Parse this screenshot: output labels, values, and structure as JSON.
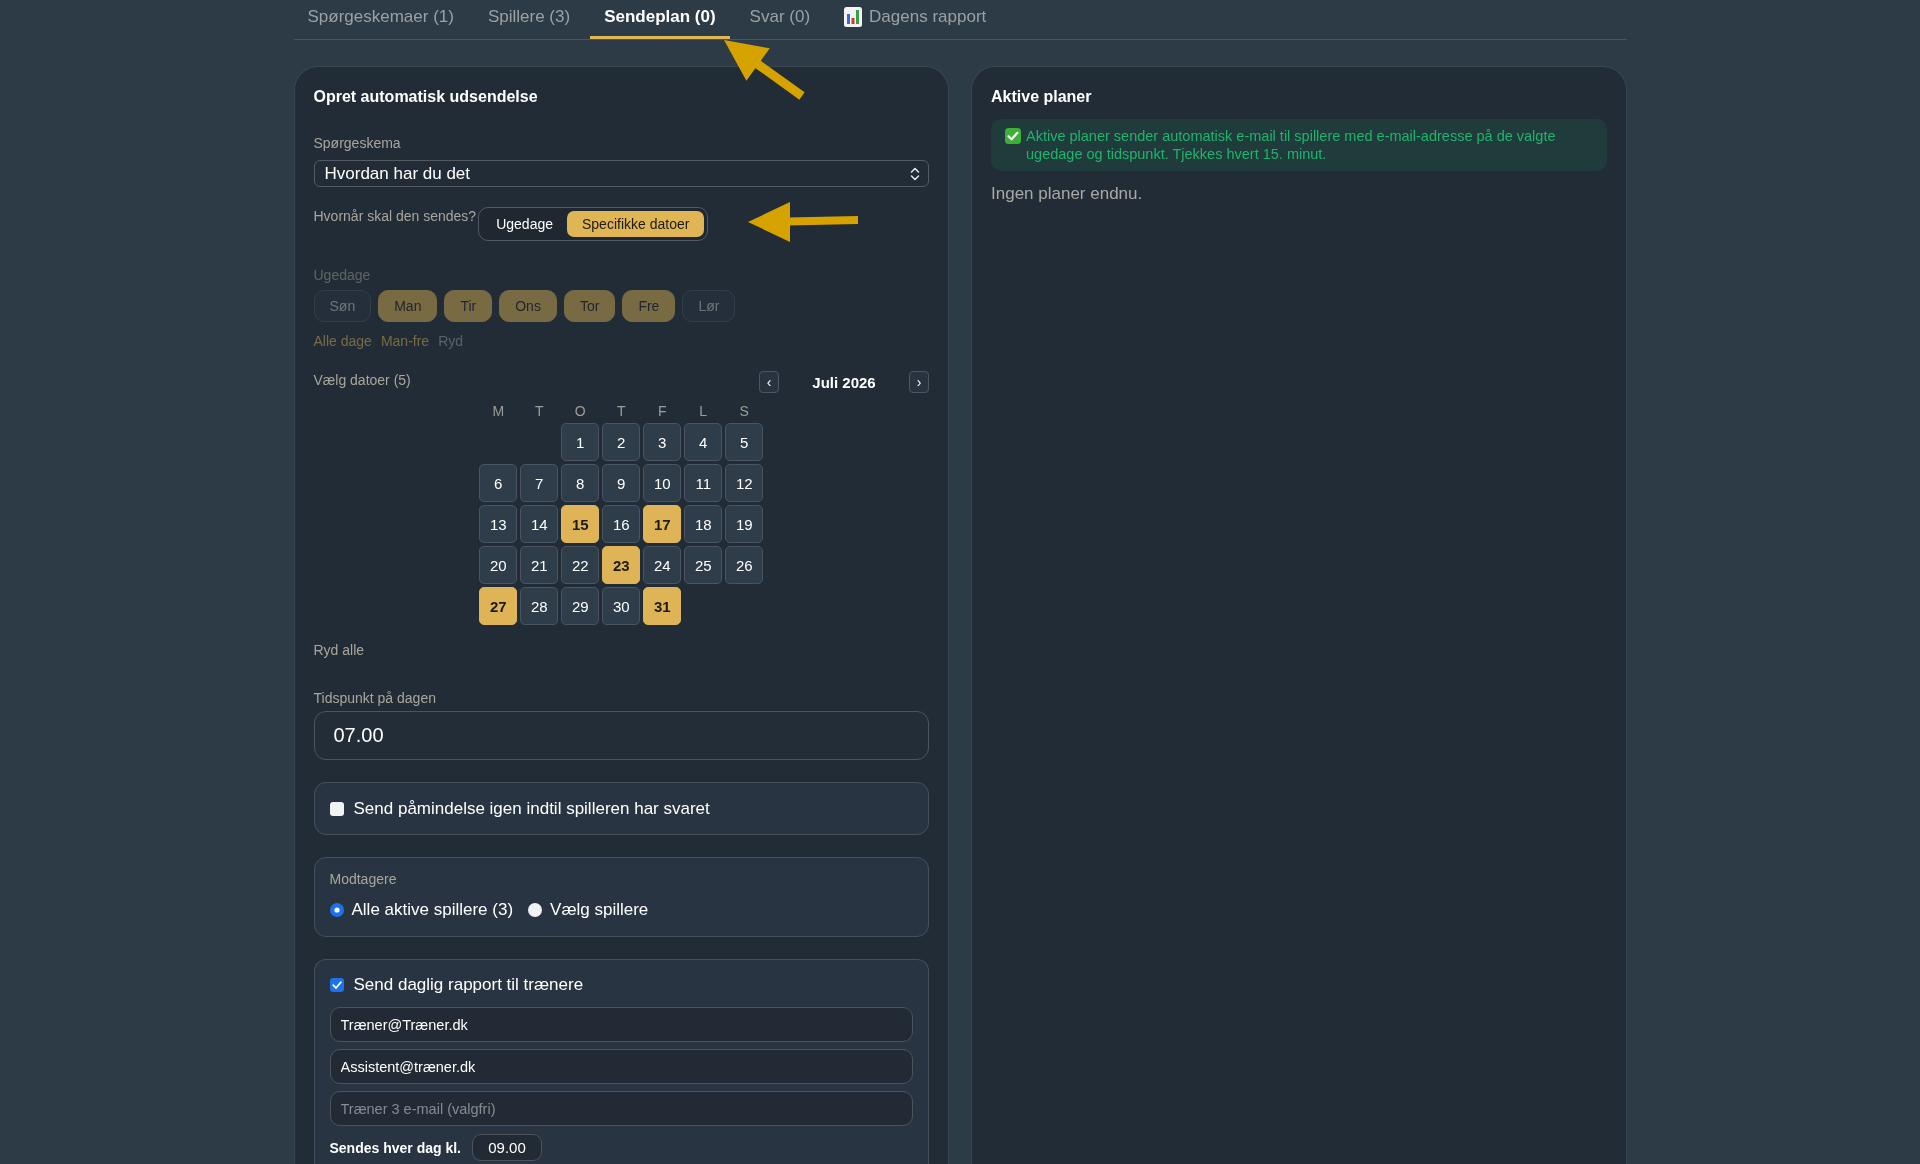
{
  "tabs": [
    {
      "label": "Spørgeskemaer (1)",
      "selected": false,
      "kind": "text"
    },
    {
      "label": "Spillere (3)",
      "selected": false,
      "kind": "text"
    },
    {
      "label": "Sendeplan (0)",
      "selected": true,
      "kind": "text"
    },
    {
      "label": "Svar (0)",
      "selected": false,
      "kind": "text"
    },
    {
      "label": "Dagens rapport",
      "selected": false,
      "kind": "report"
    }
  ],
  "create_panel": {
    "title": "Opret automatisk udsendelse",
    "questionnaire": {
      "label": "Spørgeskema",
      "value": "Hvordan har du det"
    },
    "send_mode": {
      "label": "Hvornår skal den sendes?",
      "options": [
        {
          "label": "Ugedage",
          "selected": false
        },
        {
          "label": "Specifikke datoer",
          "selected": true
        }
      ]
    },
    "weekdays": {
      "label": "Ugedage",
      "disabled": true,
      "days": [
        {
          "label": "Søn",
          "selected": false
        },
        {
          "label": "Man",
          "selected": true
        },
        {
          "label": "Tir",
          "selected": true
        },
        {
          "label": "Ons",
          "selected": true
        },
        {
          "label": "Tor",
          "selected": true
        },
        {
          "label": "Fre",
          "selected": true
        },
        {
          "label": "Lør",
          "selected": false
        }
      ],
      "shortcuts": [
        {
          "label": "Alle dage",
          "kind": "preset"
        },
        {
          "label": "Man-fre",
          "kind": "preset"
        },
        {
          "label": "Ryd",
          "kind": "clear"
        }
      ]
    },
    "date_picker": {
      "label": "Vælg datoer (5)",
      "prev": "‹",
      "month": "Juli 2026",
      "next": "›",
      "weekday_headers": [
        "M",
        "T",
        "O",
        "T",
        "F",
        "L",
        "S"
      ],
      "weeks": [
        [
          {
            "day": "1",
            "selected": false
          },
          {
            "day": "2",
            "selected": false
          },
          {
            "day": "3",
            "selected": false
          },
          {
            "day": "4",
            "selected": false
          },
          {
            "day": "5",
            "selected": false
          }
        ],
        [
          {
            "day": "6",
            "selected": false
          },
          {
            "day": "7",
            "selected": false
          },
          {
            "day": "8",
            "selected": false
          },
          {
            "day": "9",
            "selected": false
          },
          {
            "day": "10",
            "selected": false
          },
          {
            "day": "11",
            "selected": false
          },
          {
            "day": "12",
            "selected": false
          }
        ],
        [
          {
            "day": "13",
            "selected": false
          },
          {
            "day": "14",
            "selected": false
          },
          {
            "day": "15",
            "selected": true
          },
          {
            "day": "16",
            "selected": false
          },
          {
            "day": "17",
            "selected": true
          },
          {
            "day": "18",
            "selected": false
          },
          {
            "day": "19",
            "selected": false
          }
        ],
        [
          {
            "day": "20",
            "selected": false
          },
          {
            "day": "21",
            "selected": false
          },
          {
            "day": "22",
            "selected": false
          },
          {
            "day": "23",
            "selected": true
          },
          {
            "day": "24",
            "selected": false
          },
          {
            "day": "25",
            "selected": false
          },
          {
            "day": "26",
            "selected": false
          }
        ],
        [
          {
            "day": "27",
            "selected": true
          },
          {
            "day": "28",
            "selected": false
          },
          {
            "day": "29",
            "selected": false
          },
          {
            "day": "30",
            "selected": false
          },
          {
            "day": "31",
            "selected": true
          }
        ]
      ],
      "clear_label": "Ryd alle"
    },
    "time_of_day": {
      "label": "Tidspunkt på dagen",
      "value": "07.00"
    },
    "reminder": {
      "label": "Send påmindelse igen indtil spilleren har svaret",
      "checked": false
    },
    "recipients": {
      "label": "Modtagere",
      "options": [
        {
          "label": "Alle aktive spillere (3)",
          "selected": true
        },
        {
          "label": "Vælg spillere",
          "selected": false
        }
      ]
    },
    "daily_report": {
      "label": "Send daglig rapport til trænere",
      "checked": true,
      "emails": [
        {
          "value": "Træner@Træner.dk"
        },
        {
          "value": "Assistent@træner.dk"
        },
        {
          "placeholder": "Træner 3 e-mail (valgfri)"
        }
      ],
      "send_time_label": "Sendes hver dag kl.",
      "send_time": "09.00"
    }
  },
  "plans_panel": {
    "title": "Aktive planer",
    "info": "Aktive planer sender automatisk e-mail til spillere med e-mail-adresse på de valgte ugedage og tidspunkt. Tjekkes hvert 15. minut.",
    "empty_text": "Ingen planer endnu."
  }
}
